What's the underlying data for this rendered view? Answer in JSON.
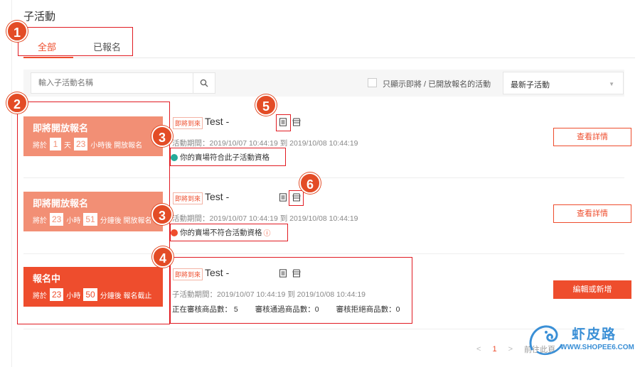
{
  "page": {
    "title": "子活動"
  },
  "tabs": [
    {
      "label": "全部",
      "active": true
    },
    {
      "label": "已報名",
      "active": false
    }
  ],
  "filters": {
    "search_placeholder": "輸入子活動名稱",
    "checkbox_label": "只顯示即將 / 已開放報名的活動",
    "checkbox_checked": false,
    "sort_value": "最新子活動"
  },
  "rows": [
    {
      "status_title": "即將開放報名",
      "status_pre": "將於",
      "status_n1": "1",
      "status_u1": "天",
      "status_n2": "23",
      "status_post": "小時後 開放報名",
      "tag": "即將到來",
      "name": "Test -",
      "period": "活動期間：2019/10/07 10:44:19 到 2019/10/08 10:44:19",
      "eligibility": "你的賣場符合此子活動資格",
      "eligible": true,
      "button": "查看詳情"
    },
    {
      "status_title": "即將開放報名",
      "status_pre": "將於",
      "status_n1": "23",
      "status_u1": "小時",
      "status_n2": "51",
      "status_post": "分鐘後 開放報名",
      "tag": "即將到來",
      "name": "Test -",
      "period": "活動期間：2019/10/07 10:44:19 到 2019/10/08 10:44:19",
      "eligibility": "你的賣場不符合活動資格",
      "eligible": false,
      "button": "查看詳情"
    },
    {
      "status_title": "報名中",
      "status_pre": "將於",
      "status_n1": "23",
      "status_u1": "小時",
      "status_n2": "50",
      "status_post": "分鐘後 報名截止",
      "tag": "即將到來",
      "name": "Test -",
      "period": "子活動期間：2019/10/07 10:44:19 到 2019/10/08 10:44:19",
      "counts": [
        "正在審核商品數： 5",
        "審核通過商品數：0",
        "審核拒絕商品數：0"
      ],
      "button": "編輯或新增"
    }
  ],
  "pagination": {
    "prev": "<",
    "current": "1",
    "next": ">",
    "jump": "前往此頁"
  },
  "annotations": [
    "1",
    "2",
    "3",
    "3",
    "4",
    "5",
    "6"
  ],
  "watermark": {
    "title": "虾皮路",
    "url": "WWW.SHOPEE6.COM"
  },
  "colors": {
    "accent": "#ee4d2d",
    "soon": "#f28f75",
    "annotation": "#e11b22",
    "success": "#26aa99",
    "watermark": "#3a8fd6"
  }
}
